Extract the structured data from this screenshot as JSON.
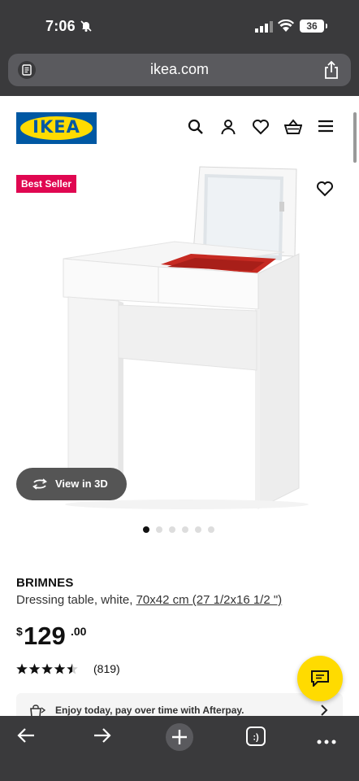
{
  "status_bar": {
    "time": "7:06",
    "battery": "36"
  },
  "browser": {
    "url": "ikea.com",
    "reader_icon": "reader-icon",
    "share_icon": "share-icon"
  },
  "header": {
    "logo_text": "IKEA",
    "icons": [
      "search-icon",
      "account-icon",
      "heart-icon",
      "basket-icon",
      "menu-icon"
    ]
  },
  "gallery": {
    "badge": "Best Seller",
    "view_3d": "View in 3D",
    "total_images": 6,
    "active_image": 1
  },
  "product": {
    "name": "BRIMNES",
    "description": "Dressing table, white, ",
    "size_link": "70x42 cm (27 1/2x16 1/2 \")",
    "price": {
      "currency": "$",
      "integer": "129",
      "decimal": ".00"
    },
    "rating": {
      "stars": 4.5,
      "out_of": 5,
      "count": "(819)"
    }
  },
  "afterpay": {
    "text": "Enjoy today, pay over time with Afterpay."
  },
  "colors": {
    "ikea_blue": "#0058a3",
    "ikea_yellow": "#ffdb00",
    "badge_red": "#e00751",
    "browser_chrome": "#3a3a3c"
  },
  "bottom_toolbar": {
    "icons": [
      "back-icon",
      "forward-icon",
      "new-tab-icon",
      "tabs-icon",
      "more-icon"
    ],
    "tabs_label": ":)"
  }
}
